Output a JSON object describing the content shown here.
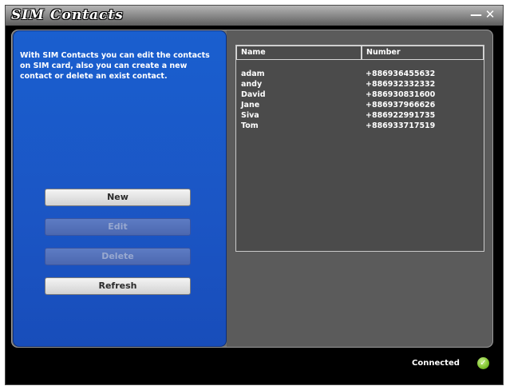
{
  "window": {
    "title": "SIM Contacts",
    "minimize_glyph": "—",
    "close_glyph": "✕"
  },
  "left_panel": {
    "description": "With SIM Contacts you can edit the contacts on SIM card, also you can create a new contact or delete an exist contact.",
    "buttons": {
      "new": "New",
      "edit": "Edit",
      "delete": "Delete",
      "refresh": "Refresh"
    }
  },
  "contacts_table": {
    "columns": [
      "Name",
      "Number"
    ],
    "rows": [
      {
        "name": "adam",
        "number": "+886936455632"
      },
      {
        "name": "andy",
        "number": "+886932332332"
      },
      {
        "name": "David",
        "number": "+886930831600"
      },
      {
        "name": "Jane",
        "number": "+886937966626"
      },
      {
        "name": "Siva",
        "number": "+886922991735"
      },
      {
        "name": "Tom",
        "number": "+886933717519"
      }
    ]
  },
  "status": {
    "text": "Connected",
    "icon": "check-icon",
    "color": "#7fc22e"
  },
  "colors": {
    "left_panel": "#1b55c4",
    "right_panel": "#5b5b5b",
    "window_bg": "#000000"
  }
}
